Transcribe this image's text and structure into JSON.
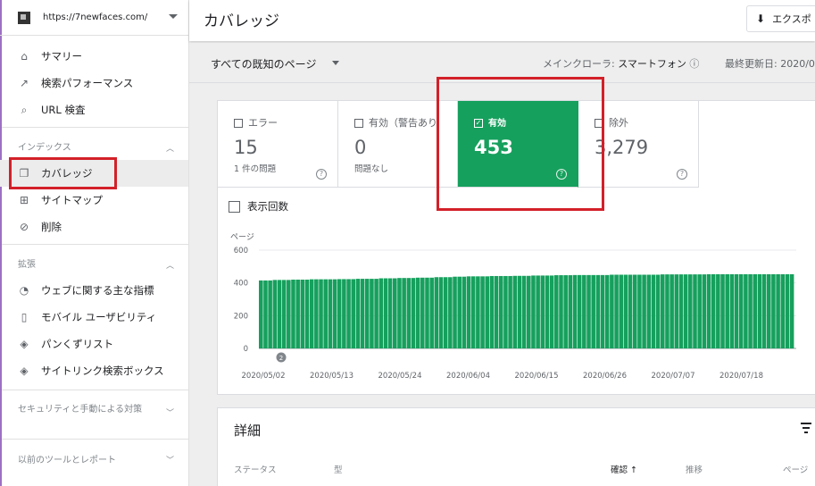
{
  "property": {
    "url": "https://7newfaces.com/"
  },
  "sidebar": {
    "top_items": [
      {
        "label": "サマリー",
        "icon": "home-icon"
      },
      {
        "label": "検索パフォーマンス",
        "icon": "trending-icon"
      },
      {
        "label": "URL 検査",
        "icon": "search-icon"
      }
    ],
    "index_section": "インデックス",
    "index_items": [
      {
        "label": "カバレッジ",
        "icon": "coverage-icon"
      },
      {
        "label": "サイトマップ",
        "icon": "sitemap-icon"
      },
      {
        "label": "削除",
        "icon": "removal-icon"
      }
    ],
    "enhance_section": "拡張",
    "enhance_items": [
      {
        "label": "ウェブに関する主な指標",
        "icon": "speed-icon"
      },
      {
        "label": "モバイル ユーザビリティ",
        "icon": "phone-icon"
      },
      {
        "label": "パンくずリスト",
        "icon": "layers-icon"
      },
      {
        "label": "サイトリンク検索ボックス",
        "icon": "layers-icon"
      }
    ],
    "security_section": "セキュリティと手動による対策",
    "legacy_section": "以前のツールとレポート"
  },
  "header": {
    "title": "カバレッジ",
    "export_label": "エクスポ"
  },
  "filterbar": {
    "select_label": "すべての既知のページ",
    "crawler_label": "メインクローラ:",
    "crawler_value": "スマートフォン",
    "updated_label": "最終更新日: 2020/0"
  },
  "tiles": [
    {
      "label": "エラー",
      "value": "15",
      "sub": "1 件の問題"
    },
    {
      "label": "有効（警告あり",
      "value": "0",
      "sub": "問題なし"
    },
    {
      "label": "有効",
      "value": "453",
      "sub": ""
    },
    {
      "label": "除外",
      "value": "3,279",
      "sub": ""
    }
  ],
  "impressions_label": "表示回数",
  "chart_data": {
    "type": "bar",
    "ylabel": "ページ",
    "ylim": [
      0,
      600
    ],
    "yticks": [
      "600",
      "400",
      "200",
      "0"
    ],
    "xticks": [
      "2020/05/02",
      "2020/05/13",
      "2020/05/24",
      "2020/06/04",
      "2020/06/15",
      "2020/06/26",
      "2020/07/07",
      "2020/07/18"
    ],
    "annotation": "2",
    "color": "#16a05d",
    "values": [
      415,
      415,
      415,
      418,
      418,
      418,
      418,
      420,
      420,
      420,
      420,
      422,
      422,
      422,
      422,
      422,
      422,
      423,
      423,
      423,
      423,
      425,
      425,
      425,
      425,
      425,
      428,
      428,
      428,
      428,
      430,
      430,
      430,
      430,
      432,
      432,
      432,
      432,
      435,
      435,
      435,
      435,
      438,
      438,
      438,
      440,
      440,
      440,
      440,
      440,
      442,
      442,
      442,
      442,
      442,
      443,
      443,
      443,
      443,
      445,
      445,
      445,
      445,
      445,
      447,
      447,
      447,
      447,
      448,
      448,
      448,
      448,
      448,
      448,
      448,
      448,
      450,
      450,
      450,
      450,
      450,
      450,
      450,
      450,
      450,
      450,
      450,
      452,
      452,
      452,
      452,
      452,
      452,
      452,
      452,
      452,
      452,
      453,
      453,
      453,
      453,
      453,
      453,
      453,
      453,
      453,
      453,
      453,
      453,
      453,
      453,
      453,
      453,
      453,
      453,
      453
    ]
  },
  "details": {
    "title": "詳細",
    "columns": [
      "ステータス",
      "型",
      "確認 ↑",
      "推移",
      "ページ"
    ]
  },
  "colors": {
    "valid_green": "#16a05d",
    "highlight_red": "#d32029"
  }
}
